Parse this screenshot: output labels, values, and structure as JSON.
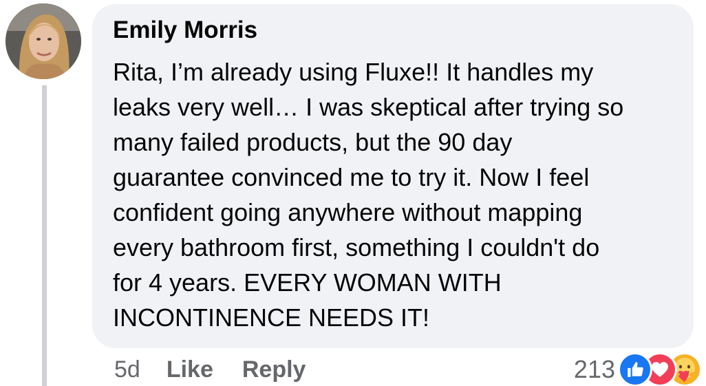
{
  "comment": {
    "author": "Emily Morris",
    "text_lines": [
      "Rita, I’m already using Fluxe!! It handles my",
      "leaks very well… I was skeptical after trying so",
      "many failed products, but the 90 day",
      "guarantee convinced me to try it. Now I feel",
      "confident going anywhere without mapping",
      "every bathroom first, something I couldn't do",
      "for 4 years. EVERY WOMAN WITH",
      "INCONTINENCE NEEDS IT!"
    ]
  },
  "actions": {
    "time": "5d",
    "like_label": "Like",
    "reply_label": "Reply"
  },
  "reactions": {
    "count": "213",
    "icons": [
      "like-icon",
      "love-icon",
      "care-icon"
    ]
  },
  "colors": {
    "bubble": "#f0f2f5",
    "text": "#050505",
    "secondary_text": "#65676b",
    "like": "#1877f2",
    "love": "#f33e58",
    "care": "#f7b125"
  }
}
